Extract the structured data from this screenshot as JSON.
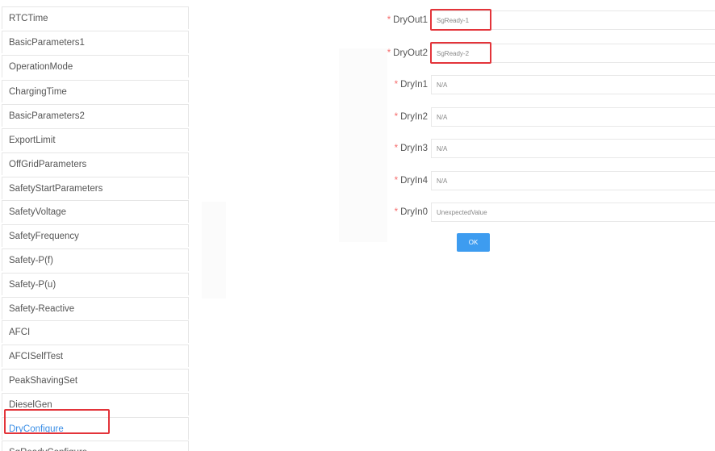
{
  "sidebar": {
    "items": [
      {
        "label": "RTCTime",
        "active": false
      },
      {
        "label": "BasicParameters1",
        "active": false
      },
      {
        "label": "OperationMode",
        "active": false
      },
      {
        "label": "ChargingTime",
        "active": false
      },
      {
        "label": "BasicParameters2",
        "active": false
      },
      {
        "label": "ExportLimit",
        "active": false
      },
      {
        "label": "OffGridParameters",
        "active": false
      },
      {
        "label": "SafetyStartParameters",
        "active": false
      },
      {
        "label": "SafetyVoltage",
        "active": false
      },
      {
        "label": "SafetyFrequency",
        "active": false
      },
      {
        "label": "Safety-P(f)",
        "active": false
      },
      {
        "label": "Safety-P(u)",
        "active": false
      },
      {
        "label": "Safety-Reactive",
        "active": false
      },
      {
        "label": "AFCI",
        "active": false
      },
      {
        "label": "AFCISelfTest",
        "active": false
      },
      {
        "label": "PeakShavingSet",
        "active": false
      },
      {
        "label": "DieselGen",
        "active": false
      },
      {
        "label": "DryConfigure",
        "active": true
      },
      {
        "label": "SgReadyConfigure",
        "active": false
      }
    ]
  },
  "form": {
    "required_mark": "*",
    "fields": [
      {
        "label": "DryOut1",
        "value": "SgReady-1",
        "highlighted": true
      },
      {
        "label": "DryOut2",
        "value": "SgReady-2",
        "highlighted": true
      },
      {
        "label": "DryIn1",
        "value": "N/A",
        "highlighted": false
      },
      {
        "label": "DryIn2",
        "value": "N/A",
        "highlighted": false
      },
      {
        "label": "DryIn3",
        "value": "N/A",
        "highlighted": false
      },
      {
        "label": "DryIn4",
        "value": "N/A",
        "highlighted": false
      },
      {
        "label": "DryIn0",
        "value": "UnexpectedValue",
        "highlighted": false
      }
    ],
    "ok_label": "OK"
  },
  "colors": {
    "active_item": "#3a8ee6",
    "highlight_border": "#e3343a",
    "ok_button": "#3d9cf0",
    "required_mark": "#f56c6c"
  }
}
